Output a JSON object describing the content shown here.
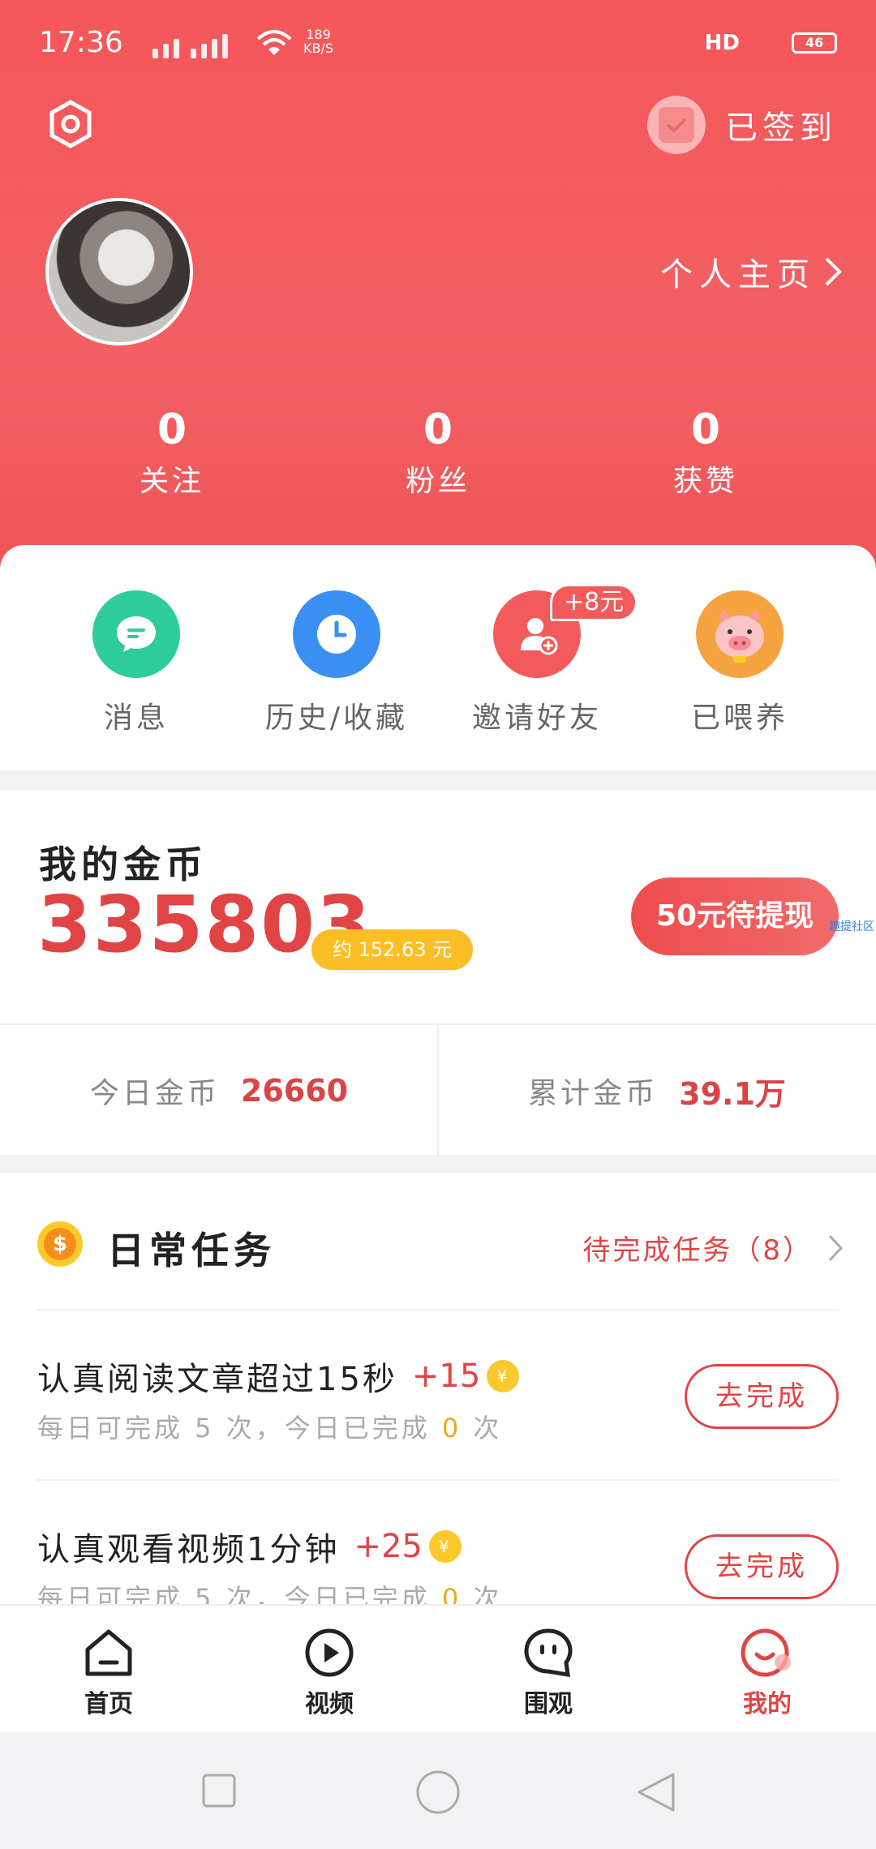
{
  "status_bar": {
    "time": "17:36",
    "speed_value": "189",
    "speed_unit": "KB/S",
    "hd": "HD",
    "battery": "46"
  },
  "header": {
    "checked_in_label": "已签到",
    "profile_link_label": "个人主页",
    "stats": [
      {
        "value": "0",
        "label": "关注"
      },
      {
        "value": "0",
        "label": "粉丝"
      },
      {
        "value": "0",
        "label": "获赞"
      }
    ]
  },
  "quick_actions": [
    {
      "label": "消息",
      "icon": "message-icon",
      "color": "#2ecc9a"
    },
    {
      "label": "历史/收藏",
      "icon": "clock-icon",
      "color": "#3b8ff2"
    },
    {
      "label": "邀请好友",
      "icon": "add-user-icon",
      "color": "#f25a5b",
      "badge": "+8元"
    },
    {
      "label": "已喂养",
      "icon": "pig-icon",
      "color": "#f5a340"
    }
  ],
  "coins": {
    "title": "我的金币",
    "amount": "335803",
    "approx": "约 152.63 元",
    "withdraw_label": "50元待提现",
    "watermark": "趣提社区",
    "today_label": "今日金币",
    "today_value": "26660",
    "total_label": "累计金币",
    "total_value": "39.1万"
  },
  "daily_tasks": {
    "title": "日常任务",
    "pending": "待完成任务（8）",
    "items": [
      {
        "name": "认真阅读文章超过15秒",
        "reward": "+15",
        "sub_prefix": "每日可完成 5 次，今日已完成 ",
        "done": "0",
        "sub_suffix": " 次",
        "button": "去完成"
      },
      {
        "name": "认真观看视频1分钟",
        "reward": "+25",
        "sub_prefix": "每日可完成 5 次，今日已完成 ",
        "done": "0",
        "sub_suffix": " 次",
        "button": "去完成"
      }
    ]
  },
  "bottom_nav": [
    {
      "label": "首页",
      "icon": "home-icon"
    },
    {
      "label": "视频",
      "icon": "play-icon"
    },
    {
      "label": "围观",
      "icon": "chat-face-icon"
    },
    {
      "label": "我的",
      "icon": "smile-icon",
      "active": true
    }
  ],
  "colors": {
    "brand_red": "#f25a5b",
    "accent_red": "#e04445",
    "gold": "#fbbe25"
  }
}
